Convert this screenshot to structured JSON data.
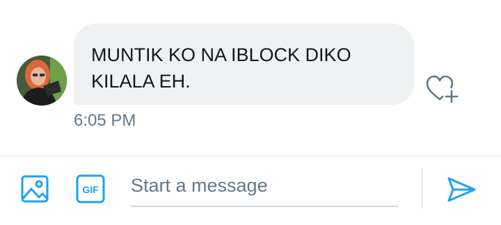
{
  "message": {
    "lines": [
      "MUNTIK KO NA IBLOCK DIKO",
      "KILALA EH."
    ],
    "timestamp": "6:05 PM"
  },
  "composer": {
    "placeholder": "Start a message",
    "value": "",
    "gif_label": "GIF"
  },
  "icons": {
    "avatar": "user-avatar",
    "like": "heart-plus-icon",
    "media": "image-icon",
    "gif": "gif-icon",
    "send": "send-icon"
  },
  "colors": {
    "accent": "#1da1f2",
    "bubble": "#eff1f2",
    "text": "#14171a",
    "muted": "#657786"
  }
}
